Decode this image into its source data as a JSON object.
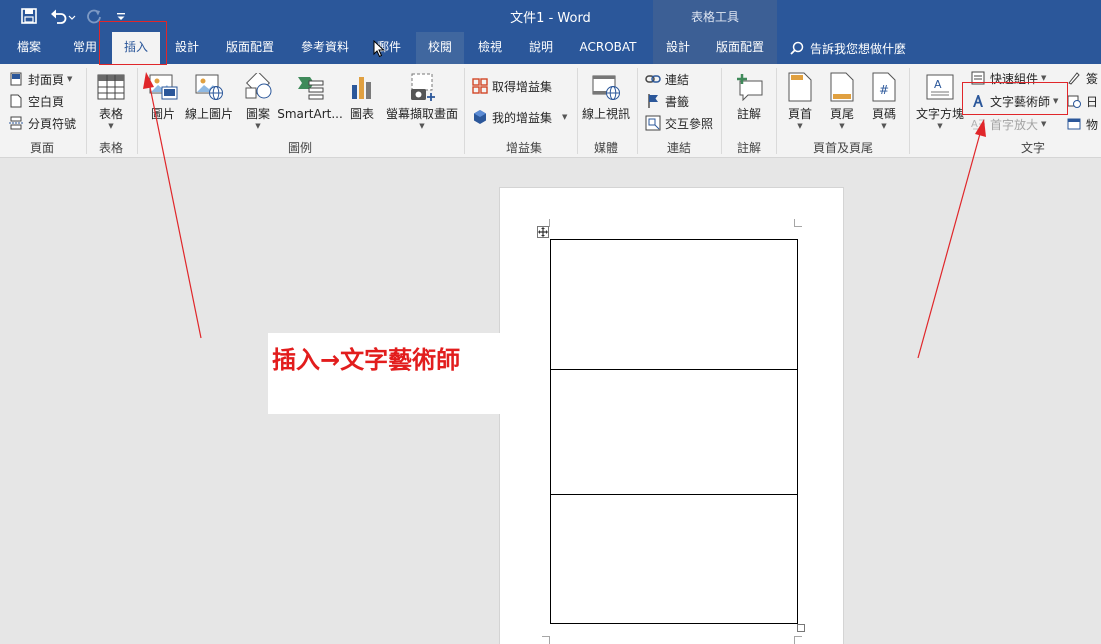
{
  "app": {
    "document_title": "文件1  -  Word",
    "context_group_title": "表格工具"
  },
  "quick_access": {
    "save_icon": "save-icon",
    "undo_icon": "undo-icon",
    "redo_icon": "redo-icon",
    "customize_icon": "customize-qat-icon"
  },
  "tabs": [
    {
      "label": "檔案"
    },
    {
      "label": "常用"
    },
    {
      "label": "插入"
    },
    {
      "label": "設計"
    },
    {
      "label": "版面配置"
    },
    {
      "label": "參考資料"
    },
    {
      "label": "郵件"
    },
    {
      "label": "校閱"
    },
    {
      "label": "檢視"
    },
    {
      "label": "說明"
    },
    {
      "label": "ACROBAT"
    },
    {
      "label": "設計"
    },
    {
      "label": "版面配置"
    }
  ],
  "active_tab": "插入",
  "tell_me": "告訴我您想做什麼",
  "ribbon": {
    "pages": {
      "label": "頁面",
      "items": [
        "封面頁",
        "空白頁",
        "分頁符號"
      ]
    },
    "tables": {
      "label": "表格",
      "table_button": "表格"
    },
    "illustrations": {
      "label": "圖例",
      "items": [
        "圖片",
        "線上圖片",
        "圖案",
        "SmartArt...",
        "圖表",
        "螢幕擷取畫面"
      ]
    },
    "addins": {
      "label": "增益集",
      "items": [
        "取得增益集",
        "我的增益集"
      ]
    },
    "media": {
      "label": "媒體",
      "online_video": "線上視訊"
    },
    "links": {
      "label": "連結",
      "items": [
        "連結",
        "書籤",
        "交互參照"
      ]
    },
    "comments": {
      "label": "註解",
      "comment_button": "註解"
    },
    "header_footer": {
      "label": "頁首及頁尾",
      "items": [
        "頁首",
        "頁尾",
        "頁碼"
      ]
    },
    "text": {
      "label": "文字",
      "text_box": "文字方塊",
      "quick_parts": "快速組件",
      "wordart": "文字藝術師",
      "drop_cap": "首字放大",
      "partial_right": [
        "簽",
        "日",
        "物"
      ]
    }
  },
  "annotation": {
    "text": "插入→文字藝術師",
    "color": "#e21d1d"
  },
  "colors": {
    "title_bar": "#2b579a",
    "context_tab": "#3c5f95",
    "ribbon": "#f3f3f3",
    "canvas": "#e6e6e6"
  }
}
